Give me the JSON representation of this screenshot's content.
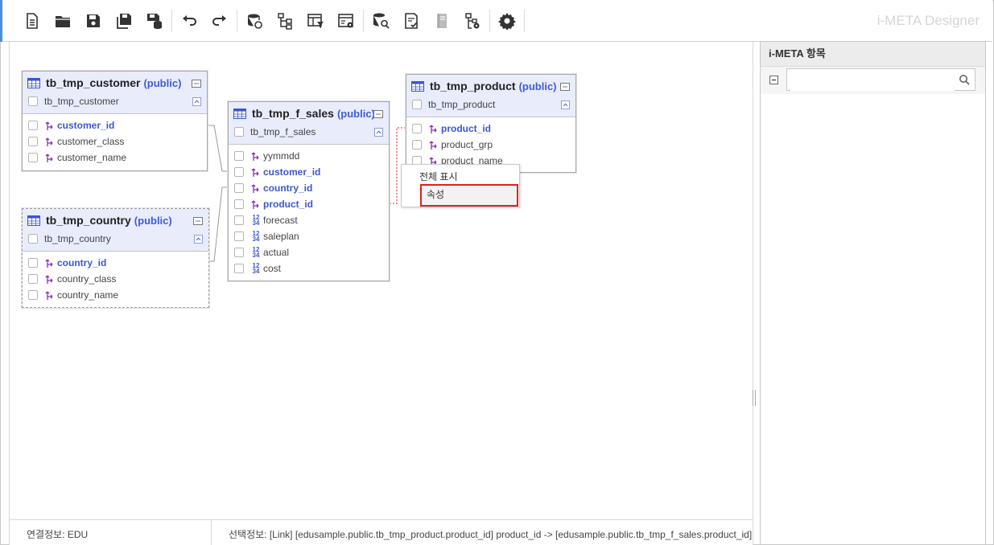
{
  "app": {
    "title": "i-META Designer"
  },
  "toolbar": {
    "buttons": [
      {
        "icon": "new-document-icon"
      },
      {
        "icon": "open-folder-icon"
      },
      {
        "icon": "save-icon"
      },
      {
        "icon": "save-all-icon"
      },
      {
        "icon": "save-db-icon"
      },
      {
        "icon": "undo-icon"
      },
      {
        "icon": "redo-icon"
      },
      {
        "icon": "db-connect-icon"
      },
      {
        "icon": "hierarchy-icon"
      },
      {
        "icon": "table-filter-icon"
      },
      {
        "icon": "window-settings-icon"
      },
      {
        "icon": "db-search-icon"
      },
      {
        "icon": "checklist-icon"
      },
      {
        "icon": "document-icon"
      },
      {
        "icon": "tree-settings-icon"
      },
      {
        "icon": "gear-icon"
      }
    ]
  },
  "entities": {
    "customer": {
      "name": "tb_tmp_customer",
      "schema": "(public)",
      "sub": "tb_tmp_customer",
      "columns": [
        {
          "name": "customer_id",
          "key": true,
          "type": "link"
        },
        {
          "name": "customer_class",
          "key": false,
          "type": "link"
        },
        {
          "name": "customer_name",
          "key": false,
          "type": "link"
        }
      ]
    },
    "country": {
      "name": "tb_tmp_country",
      "schema": "(public)",
      "sub": "tb_tmp_country",
      "columns": [
        {
          "name": "country_id",
          "key": true,
          "type": "link"
        },
        {
          "name": "country_class",
          "key": false,
          "type": "link"
        },
        {
          "name": "country_name",
          "key": false,
          "type": "link"
        }
      ]
    },
    "sales": {
      "name": "tb_tmp_f_sales",
      "schema": "(public)",
      "sub": "tb_tmp_f_sales",
      "columns": [
        {
          "name": "yymmdd",
          "key": false,
          "type": "link"
        },
        {
          "name": "customer_id",
          "key": true,
          "type": "link"
        },
        {
          "name": "country_id",
          "key": true,
          "type": "link"
        },
        {
          "name": "product_id",
          "key": true,
          "type": "link"
        },
        {
          "name": "forecast",
          "key": false,
          "type": "number"
        },
        {
          "name": "saleplan",
          "key": false,
          "type": "number"
        },
        {
          "name": "actual",
          "key": false,
          "type": "number"
        },
        {
          "name": "cost",
          "key": false,
          "type": "number"
        }
      ]
    },
    "product": {
      "name": "tb_tmp_product",
      "schema": "(public)",
      "sub": "tb_tmp_product",
      "columns": [
        {
          "name": "product_id",
          "key": true,
          "type": "link"
        },
        {
          "name": "product_grp",
          "key": false,
          "type": "link"
        },
        {
          "name": "product_name",
          "key": false,
          "type": "link"
        }
      ]
    }
  },
  "number_icon": {
    "top": "12",
    "bottom": "34"
  },
  "context_menu": {
    "items": [
      "전체 표시",
      "속성"
    ]
  },
  "panel": {
    "title": "i-META 항목",
    "search_placeholder": "",
    "search_value": ""
  },
  "status": {
    "connection": "연결정보: EDU",
    "selection": "선택정보: [Link] [edusample.public.tb_tmp_product.product_id] product_id -> [edusample.public.tb_tmp_f_sales.product_id]"
  },
  "colors": {
    "accent": "#4a90d9",
    "header_bg": "#e8ecfb",
    "key_text": "#3a57d0",
    "highlight": "#e02020",
    "link_icon": "#8a2fb5"
  }
}
